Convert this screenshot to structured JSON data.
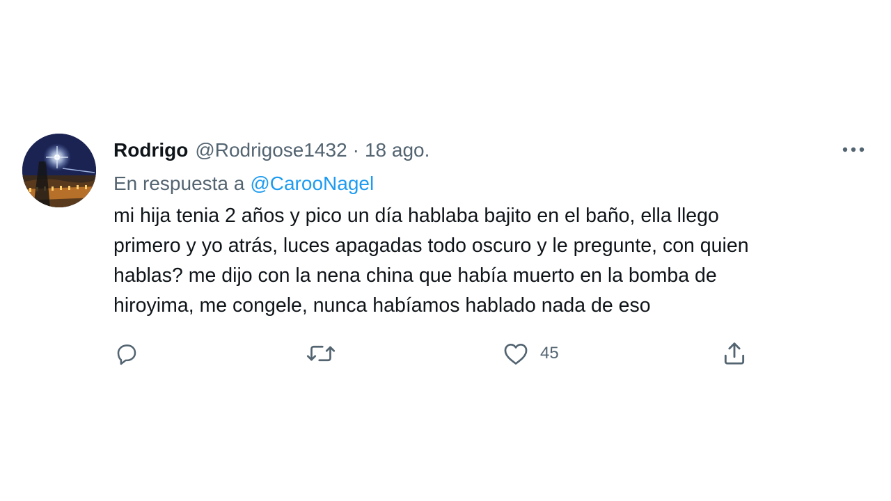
{
  "tweet": {
    "display_name": "Rodrigo",
    "handle": "@Rodrigose1432",
    "separator": "·",
    "timestamp": "18 ago.",
    "reply_prefix": "En respuesta a",
    "reply_mention": "@CarooNagel",
    "text": "mi hija tenia 2 años y pico un día hablaba bajito en el baño, ella llego\nprimero y yo atrás, luces apagadas todo oscuro y le pregunte, con quien\nhablas? me dijo con la nena china que había muerto en la bomba de\nhiroyima, me congele, nunca habíamos hablado nada de eso"
  },
  "actions": {
    "reply_icon": "comment-icon",
    "retweet_icon": "retweet-icon",
    "like_icon": "heart-icon",
    "like_count": "45",
    "share_icon": "share-icon"
  },
  "colors": {
    "text": "#0f1419",
    "secondary": "#536471",
    "link": "#1d9bf0"
  }
}
